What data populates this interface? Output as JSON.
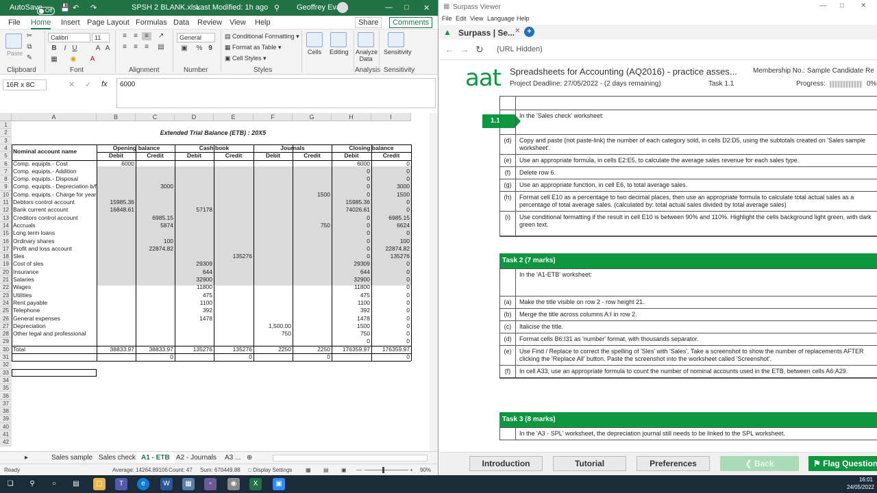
{
  "excel": {
    "autosave_label": "AutoSave",
    "autosave_state": "Off",
    "filename": "SPSH 2 BLANK.xlsx",
    "modified": "Last Modified: 1h ago",
    "user": "Geoffrey Evans",
    "tabs": [
      "File",
      "Home",
      "Insert",
      "Page Layout",
      "Formulas",
      "Data",
      "Review",
      "View",
      "Help"
    ],
    "share": "Share",
    "comments": "Comments",
    "ribbon": {
      "clipboard": "Clipboard",
      "paste": "Paste",
      "font": "Font",
      "font_name": "Calibri",
      "font_size": "11",
      "alignment": "Alignment",
      "number": "Number",
      "number_format": "General",
      "conditional": "Conditional Formatting",
      "format_table": "Format as Table",
      "cell_styles": "Cell Styles",
      "styles": "Styles",
      "cells": "Cells",
      "editing": "Editing",
      "analyze": "Analyze Data",
      "analysis": "Analysis",
      "sensitivity": "Sensitivity"
    },
    "namebox": "16R x 8C",
    "formula": "6000",
    "columns": [
      "A",
      "B",
      "C",
      "D",
      "E",
      "F",
      "G",
      "H",
      "I"
    ],
    "sheet_title": "Extended Trial Balance (ETB) : 20X5",
    "groups": [
      "Opening balance",
      "Cash book",
      "Journals",
      "Closing balance"
    ],
    "subheads": [
      "Debit",
      "Credit",
      "Debit",
      "Credit",
      "Debit",
      "Credit",
      "Debit",
      "Credit"
    ],
    "row_label_head": "Nominal account name",
    "rows": [
      {
        "n": "6",
        "a": "Comp. equipts.- Cost",
        "b": "6000",
        "c": "",
        "d": "",
        "e": "",
        "f": "",
        "g": "",
        "h": "6000",
        "i": "0"
      },
      {
        "n": "7",
        "a": "Comp. equipts.- Addition",
        "b": "",
        "c": "",
        "d": "",
        "e": "",
        "f": "",
        "g": "",
        "h": "0",
        "i": "0"
      },
      {
        "n": "8",
        "a": "Comp. equipts.- Disposal",
        "b": "",
        "c": "",
        "d": "",
        "e": "",
        "f": "",
        "g": "",
        "h": "0",
        "i": "0"
      },
      {
        "n": "9",
        "a": "Comp. equipts.- Depreciation b/f",
        "b": "",
        "c": "3000",
        "d": "",
        "e": "",
        "f": "",
        "g": "",
        "h": "0",
        "i": "3000"
      },
      {
        "n": "10",
        "a": "Comp. equipts.- Charge for year",
        "b": "",
        "c": "",
        "d": "",
        "e": "",
        "f": "",
        "g": "1500",
        "h": "0",
        "i": "1500"
      },
      {
        "n": "11",
        "a": "Debtors control account",
        "b": "15985.36",
        "c": "",
        "d": "",
        "e": "",
        "f": "",
        "g": "",
        "h": "15985.36",
        "i": "0"
      },
      {
        "n": "12",
        "a": "Bank current account",
        "b": "16848.61",
        "c": "",
        "d": "57178",
        "e": "",
        "f": "",
        "g": "",
        "h": "74026.61",
        "i": "0"
      },
      {
        "n": "13",
        "a": "Creditors control account",
        "b": "",
        "c": "6985.15",
        "d": "",
        "e": "",
        "f": "",
        "g": "",
        "h": "0",
        "i": "6985.15"
      },
      {
        "n": "14",
        "a": "Accruals",
        "b": "",
        "c": "5874",
        "d": "",
        "e": "",
        "f": "",
        "g": "750",
        "h": "0",
        "i": "6624"
      },
      {
        "n": "15",
        "a": "Long term loans",
        "b": "",
        "c": "",
        "d": "",
        "e": "",
        "f": "",
        "g": "",
        "h": "0",
        "i": "0"
      },
      {
        "n": "16",
        "a": "Ordinary shares",
        "b": "",
        "c": "100",
        "d": "",
        "e": "",
        "f": "",
        "g": "",
        "h": "0",
        "i": "100"
      },
      {
        "n": "17",
        "a": "Profit and loss account",
        "b": "",
        "c": "22874.82",
        "d": "",
        "e": "",
        "f": "",
        "g": "",
        "h": "0",
        "i": "22874.82"
      },
      {
        "n": "18",
        "a": "Sles",
        "b": "",
        "c": "",
        "d": "",
        "e": "135276",
        "f": "",
        "g": "",
        "h": "0",
        "i": "135276"
      },
      {
        "n": "19",
        "a": "Cost of sles",
        "b": "",
        "c": "",
        "d": "29309",
        "e": "",
        "f": "",
        "g": "",
        "h": "29309",
        "i": "0"
      },
      {
        "n": "20",
        "a": "Insurance",
        "b": "",
        "c": "",
        "d": "644",
        "e": "",
        "f": "",
        "g": "",
        "h": "644",
        "i": "0"
      },
      {
        "n": "21",
        "a": "Salaries",
        "b": "",
        "c": "",
        "d": "32900",
        "e": "",
        "f": "",
        "g": "",
        "h": "32900",
        "i": "0"
      },
      {
        "n": "22",
        "a": "Wages",
        "b": "",
        "c": "",
        "d": "11800",
        "e": "",
        "f": "",
        "g": "",
        "h": "11800",
        "i": "0"
      },
      {
        "n": "23",
        "a": "Utilities",
        "b": "",
        "c": "",
        "d": "475",
        "e": "",
        "f": "",
        "g": "",
        "h": "475",
        "i": "0"
      },
      {
        "n": "24",
        "a": "Rent payable",
        "b": "",
        "c": "",
        "d": "1100",
        "e": "",
        "f": "",
        "g": "",
        "h": "1100",
        "i": "0"
      },
      {
        "n": "25",
        "a": "Telephone",
        "b": "",
        "c": "",
        "d": "392",
        "e": "",
        "f": "",
        "g": "",
        "h": "392",
        "i": "0"
      },
      {
        "n": "26",
        "a": "General expenses",
        "b": "",
        "c": "",
        "d": "1478",
        "e": "",
        "f": "",
        "g": "",
        "h": "1478",
        "i": "0"
      },
      {
        "n": "27",
        "a": "Depreciation",
        "b": "",
        "c": "",
        "d": "",
        "e": "",
        "f": "1,500.00",
        "g": "",
        "h": "1500",
        "i": "0"
      },
      {
        "n": "28",
        "a": "Other legal and professional",
        "b": "",
        "c": "",
        "d": "",
        "e": "",
        "f": "750",
        "g": "",
        "h": "750",
        "i": "0"
      },
      {
        "n": "29",
        "a": "",
        "b": "",
        "c": "",
        "d": "",
        "e": "",
        "f": "",
        "g": "",
        "h": "0",
        "i": "0"
      },
      {
        "n": "30",
        "a": "Total",
        "b": "38833.97",
        "c": "38833.97",
        "d": "135276",
        "e": "135276",
        "f": "2250",
        "g": "2250",
        "h": "176359.97",
        "i": "176359.97"
      },
      {
        "n": "31",
        "a": "",
        "b": "",
        "c": "0",
        "d": "",
        "e": "0",
        "f": "",
        "g": "0",
        "h": "",
        "i": "0"
      }
    ],
    "extra_rows": [
      "32",
      "33",
      "34",
      "35",
      "36",
      "37",
      "38",
      "39",
      "40",
      "41",
      "42"
    ],
    "header_rows": [
      "1",
      "2",
      "3",
      "4",
      "5"
    ],
    "sheet_tabs": [
      "Sales sample",
      "Sales check",
      "A1 - ETB",
      "A2 - Journals",
      "A3 ..."
    ],
    "status": {
      "ready": "Ready",
      "average": "Average: 14264.89106",
      "count": "Count: 47",
      "sum": "Sum: 670449.88",
      "display": "Display Settings",
      "zoom": "90%"
    }
  },
  "surpass": {
    "window_title": "Surpass Viewer",
    "menu": [
      "File",
      "Edit",
      "View",
      "Language",
      "Help"
    ],
    "tab": "Surpass | Se...",
    "url": "(URL Hidden)",
    "logo": "aat",
    "exam_title": "Spreadsheets for Accounting (AQ2016) - practice asses...",
    "membership": "Membership No.: Sample Candidate Re",
    "deadline": "Project Deadline:  27/05/2022 - (2 days remaining)",
    "task": "Task 1.1",
    "progress_label": "Progress:",
    "progress_value": "0%",
    "progress": 0,
    "flag": "1.1",
    "task1_rows": [
      {
        "l": "",
        "t": ""
      },
      {
        "l": "",
        "t": "In the 'Sales check' worksheet:"
      },
      {
        "l": "(d)",
        "t": "Copy and paste (not paste-link) the number of each category sold, in cells D2:D5, using the subtotals created on 'Sales sample worksheet'."
      },
      {
        "l": "(e)",
        "t": "Use an appropriate formula, in cells E2:E5, to calculate the average sales revenue for each sales type."
      },
      {
        "l": "(f)",
        "t": "Delete row 6."
      },
      {
        "l": "(g)",
        "t": "Use an appropriate function, in cell E6, to total average sales."
      },
      {
        "l": "(h)",
        "t": "Format cell E10 as a percentage to two decimal places, then use an appropriate formula to calculate total actual sales as a percentage of total average sales. (calculated by: total actual sales divided by total average sales)"
      },
      {
        "l": "(i)",
        "t": "Use conditional formatting if the result in cell E10 is between 90% and 110%. Highlight the cells background light green, with dark green text."
      }
    ],
    "task2_title": "Task 2 (7 marks)",
    "task2_rows": [
      {
        "l": "",
        "t": "In the 'A1-ETB' worksheet:"
      },
      {
        "l": "(a)",
        "t": "Make the title visible on row 2 - row height 21."
      },
      {
        "l": "(b)",
        "t": "Merge the title across columns A:I in row 2."
      },
      {
        "l": "(c)",
        "t": "Italicise the title."
      },
      {
        "l": "(d)",
        "t": "Format cells B6:I31 as 'number' format, with thousands separator."
      },
      {
        "l": "(e)",
        "t": "Use Find / Replace to correct the spelling of 'Sles' with 'Sales'. Take a screenshot to show the number of replacements AFTER clicking the 'Replace All' button. Paste the screenshot into the worksheet called 'Screenshot'."
      },
      {
        "l": "(f)",
        "t": "In cell A33, use an appropriate formula to count the number of nominal accounts used in the ETB, between cells A6:A29."
      }
    ],
    "task3_title": "Task 3 (8 marks)",
    "task3_rows": [
      {
        "l": "",
        "t": "In the 'A3 - SPL' worksheet, the depreciation journal still needs to be linked to the SPL worksheet."
      }
    ],
    "footer": {
      "intro": "Introduction",
      "tutorial": "Tutorial",
      "prefs": "Preferences",
      "back": "Back",
      "flag": "Flag Question"
    }
  },
  "taskbar": {
    "time": "16:01",
    "date": "24/05/2022"
  }
}
